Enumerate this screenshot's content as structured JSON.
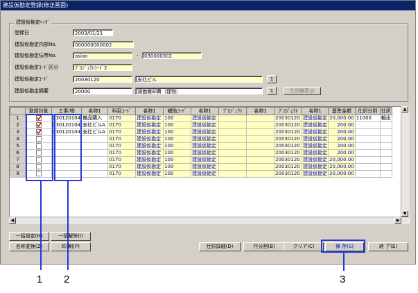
{
  "window": {
    "title": "建設仮勘定登録(修正画面)"
  },
  "header_group": {
    "label": "建設仮勘定ﾍｯﾀﾞ",
    "fields": {
      "reg_date_label": "登録日",
      "reg_date": "2003/01/21",
      "approval_no_label": "建設仮勘定内部No.",
      "approval_no": "000000000002",
      "slip_no_label": "建設仮勘定伝票No.",
      "slip_no_a": "asian",
      "slip_no_sep": "-",
      "slip_no_b": "030000002",
      "code_kbn_label": "建設仮勘定ｺｰﾄﾞ区分",
      "code_kbn": "ﾌﾟﾛｼﾞｪｸﾄｺｰﾄﾞ2",
      "code_label": "建設仮勘定ｺｰﾄﾞ",
      "code": "20030120",
      "code_name": "支社ビル",
      "code_btn": "1",
      "summary_label": "建設仮勘定摘要",
      "summary": "20000",
      "summary_name": "減価償却費（建物）",
      "summary_btn": "1",
      "journal_search_btn": "仕訳検索(J)"
    }
  },
  "grid": {
    "columns": [
      "",
      "登録対象",
      "工事/物",
      "名称1",
      "科目ｺｰﾄﾞ",
      "名称1",
      "補助ｺｰﾄﾞ",
      "名称1",
      "ﾌﾟﾛｼﾞｪｸﾄ",
      "名称1",
      "ﾌﾟﾛｼﾞｪｸﾄ",
      "名称1",
      "基準金額",
      "仕訳分割",
      "仕訳"
    ],
    "rows": [
      {
        "n": "1",
        "checked": true,
        "koji": "030120104",
        "name1": "備品購入",
        "kamoku": "0170",
        "k_name": "建設仮勘定",
        "hojo": "100",
        "h_name": "建設仮勘定",
        "pj1": "",
        "pj1_name": "",
        "pj2": "20030120",
        "pj2_name": "建設仮勘定",
        "amount": "20,000.00",
        "bunkatsu": "11000",
        "shiwake": "輸出"
      },
      {
        "n": "2",
        "checked": true,
        "koji": "030120104",
        "name1": "支社ビルA",
        "kamoku": "0170",
        "k_name": "建設仮勘定",
        "hojo": "100",
        "h_name": "建設仮勘定",
        "pj1": "",
        "pj1_name": "",
        "pj2": "20030120",
        "pj2_name": "建設仮勘定",
        "amount": "200.00",
        "bunkatsu": "",
        "shiwake": ""
      },
      {
        "n": "3",
        "checked": true,
        "koji": "030120104",
        "name1": "支社ビルA",
        "kamoku": "0170",
        "k_name": "建設仮勘定",
        "hojo": "100",
        "h_name": "建設仮勘定",
        "pj1": "",
        "pj1_name": "",
        "pj2": "20030120",
        "pj2_name": "建設仮勘定",
        "amount": "200.00",
        "bunkatsu": "",
        "shiwake": ""
      },
      {
        "n": "4",
        "checked": false,
        "koji": "",
        "name1": "",
        "kamoku": "0170",
        "k_name": "建設仮勘定",
        "hojo": "100",
        "h_name": "建設仮勘定",
        "pj1": "",
        "pj1_name": "",
        "pj2": "20030120",
        "pj2_name": "建設仮勘定",
        "amount": "200.00",
        "bunkatsu": "",
        "shiwake": ""
      },
      {
        "n": "5",
        "checked": false,
        "koji": "",
        "name1": "",
        "kamoku": "0170",
        "k_name": "建設仮勘定",
        "hojo": "100",
        "h_name": "建設仮勘定",
        "pj1": "",
        "pj1_name": "",
        "pj2": "20030120",
        "pj2_name": "建設仮勘定",
        "amount": "200.00",
        "bunkatsu": "",
        "shiwake": ""
      },
      {
        "n": "6",
        "checked": false,
        "koji": "",
        "name1": "",
        "kamoku": "0170",
        "k_name": "建設仮勘定",
        "hojo": "100",
        "h_name": "建設仮勘定",
        "pj1": "",
        "pj1_name": "",
        "pj2": "20030120",
        "pj2_name": "建設仮勘定",
        "amount": "200.00",
        "bunkatsu": "",
        "shiwake": ""
      },
      {
        "n": "7",
        "checked": false,
        "koji": "",
        "name1": "",
        "kamoku": "0170",
        "k_name": "建設仮勘定",
        "hojo": "100",
        "h_name": "建設仮勘定",
        "pj1": "",
        "pj1_name": "",
        "pj2": "20030120",
        "pj2_name": "建設仮勘定",
        "amount": "20,000.00",
        "bunkatsu": "",
        "shiwake": ""
      },
      {
        "n": "8",
        "checked": false,
        "koji": "",
        "name1": "",
        "kamoku": "0170",
        "k_name": "建設仮勘定",
        "hojo": "100",
        "h_name": "建設仮勘定",
        "pj1": "",
        "pj1_name": "",
        "pj2": "20030120",
        "pj2_name": "建設仮勘定",
        "amount": "20,000.00",
        "bunkatsu": "",
        "shiwake": ""
      },
      {
        "n": "9",
        "checked": false,
        "koji": "",
        "name1": "",
        "kamoku": "0170",
        "k_name": "建設仮勘定",
        "hojo": "100",
        "h_name": "建設仮勘定",
        "pj1": "",
        "pj1_name": "",
        "pj2": "20030120",
        "pj2_name": "建設仮勘定",
        "amount": "20,000.00",
        "bunkatsu": "",
        "shiwake": ""
      }
    ]
  },
  "buttons": {
    "bulk_set": "一括設定(H)",
    "bulk_clear": "一括解除(I)",
    "name_convert": "名称変換(Z)",
    "print": "印 刷(P)",
    "journal_detail": "仕訳詳細(D)",
    "row_split": "行分割(B)",
    "clear": "クリア(C)",
    "save": "保 存(S)",
    "exit": "終 了(E)"
  },
  "callouts": [
    "1",
    "2",
    "3"
  ],
  "colors": {
    "highlight": "#1f3bd8",
    "title_bar": "#0a246a",
    "input_yellow": "#ffffc0"
  }
}
